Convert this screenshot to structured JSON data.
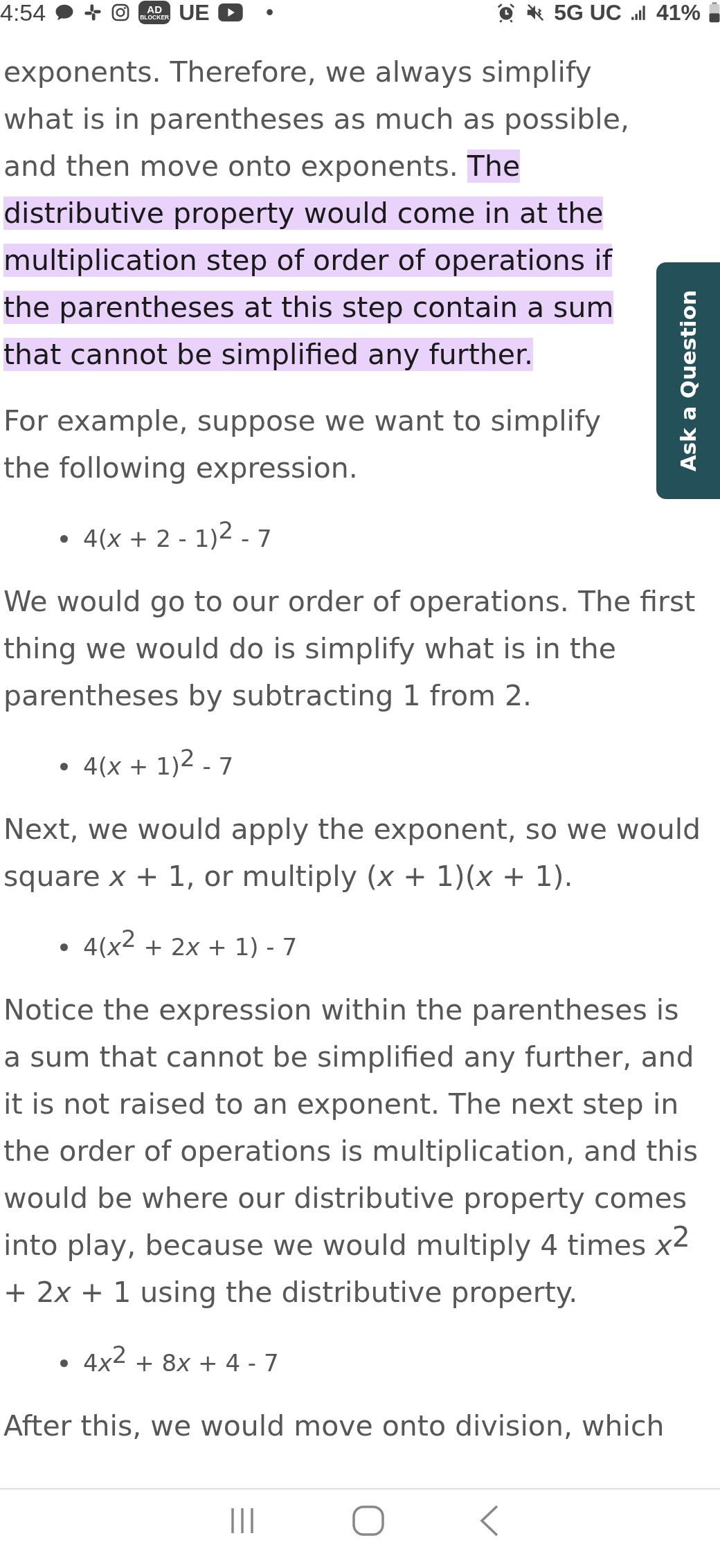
{
  "status_bar": {
    "time": "4:54",
    "left_texts": {
      "ad_badge_top": "AD",
      "ad_badge_bottom": "BLOCKER",
      "app": "UE",
      "dot": "•"
    },
    "network": "5G UC",
    "battery": "41%"
  },
  "article": [
    {
      "kind": "paragraph",
      "segments": [
        {
          "kind": "text",
          "text": "exponents. Therefore, we always simplify what is in parentheses as much as possible, and then move onto exponents. ",
          "highlighted": false
        },
        {
          "kind": "text",
          "text": "The distributive property would come in at the multiplication step of order of operations if the parentheses at this step contain a sum that cannot be simplified any further.",
          "highlighted": true
        }
      ]
    },
    {
      "kind": "paragraph",
      "segments": [
        {
          "kind": "text",
          "text": "For example, suppose we want to simplify the following expression.",
          "highlighted": false
        }
      ]
    },
    {
      "kind": "bullet",
      "segments": [
        {
          "kind": "text",
          "text": "4("
        },
        {
          "kind": "variable",
          "text": "x"
        },
        {
          "kind": "text",
          "text": " + 2 - 1)"
        },
        {
          "kind": "exponent",
          "text": "2"
        },
        {
          "kind": "text",
          "text": " - 7"
        }
      ]
    },
    {
      "kind": "paragraph",
      "segments": [
        {
          "kind": "text",
          "text": "We would go to our order of operations. The first thing we would do is simplify what is in the parentheses by subtracting 1 from 2.",
          "highlighted": false
        }
      ]
    },
    {
      "kind": "bullet",
      "segments": [
        {
          "kind": "text",
          "text": "4("
        },
        {
          "kind": "variable",
          "text": "x"
        },
        {
          "kind": "text",
          "text": " + 1)"
        },
        {
          "kind": "exponent",
          "text": "2"
        },
        {
          "kind": "text",
          "text": " - 7"
        }
      ]
    },
    {
      "kind": "paragraph",
      "segments": [
        {
          "kind": "text",
          "text": "Next, we would apply the exponent, so we would square ",
          "highlighted": false
        },
        {
          "kind": "variable",
          "text": "x"
        },
        {
          "kind": "text",
          "text": " + 1, or multiply (",
          "highlighted": false
        },
        {
          "kind": "variable",
          "text": "x"
        },
        {
          "kind": "text",
          "text": " + 1)(",
          "highlighted": false
        },
        {
          "kind": "variable",
          "text": "x"
        },
        {
          "kind": "text",
          "text": " + 1).",
          "highlighted": false
        }
      ]
    },
    {
      "kind": "bullet",
      "segments": [
        {
          "kind": "text",
          "text": "4("
        },
        {
          "kind": "variable",
          "text": "x"
        },
        {
          "kind": "exponent",
          "text": "2"
        },
        {
          "kind": "text",
          "text": " + 2"
        },
        {
          "kind": "variable",
          "text": "x"
        },
        {
          "kind": "text",
          "text": " + 1) - 7"
        }
      ]
    },
    {
      "kind": "paragraph",
      "segments": [
        {
          "kind": "text",
          "text": "Notice the expression within the parentheses is a sum that cannot be simplified any further, and it is not raised to an exponent. The next step in the order of operations is multiplication, and this would be where our distributive property comes into play, because we would multiply 4 times ",
          "highlighted": false
        },
        {
          "kind": "variable",
          "text": "x"
        },
        {
          "kind": "exponent",
          "text": "2"
        },
        {
          "kind": "text",
          "text": " + 2",
          "highlighted": false
        },
        {
          "kind": "variable",
          "text": "x"
        },
        {
          "kind": "text",
          "text": " + 1 using the distributive property.",
          "highlighted": false
        }
      ]
    },
    {
      "kind": "bullet",
      "segments": [
        {
          "kind": "text",
          "text": "4"
        },
        {
          "kind": "variable",
          "text": "x"
        },
        {
          "kind": "exponent",
          "text": "2"
        },
        {
          "kind": "text",
          "text": " + 8"
        },
        {
          "kind": "variable",
          "text": "x"
        },
        {
          "kind": "text",
          "text": " + 4 - 7"
        }
      ]
    },
    {
      "kind": "paragraph",
      "segments": [
        {
          "kind": "text",
          "text": "After this, we would move onto division, which",
          "highlighted": false
        }
      ]
    }
  ],
  "ask_tab": {
    "label": "Ask a Question"
  }
}
